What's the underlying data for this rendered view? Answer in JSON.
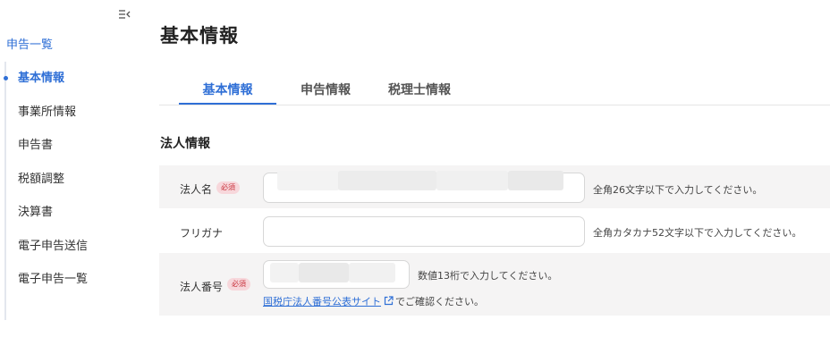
{
  "sidebar": {
    "top_link": "申告一覧",
    "items": [
      {
        "label": "基本情報",
        "active": true
      },
      {
        "label": "事業所情報",
        "active": false
      },
      {
        "label": "申告書",
        "active": false
      },
      {
        "label": "税額調整",
        "active": false
      },
      {
        "label": "決算書",
        "active": false
      },
      {
        "label": "電子申告送信",
        "active": false
      },
      {
        "label": "電子申告一覧",
        "active": false
      }
    ]
  },
  "page": {
    "title": "基本情報"
  },
  "tabs": [
    {
      "label": "基本情報",
      "active": true
    },
    {
      "label": "申告情報",
      "active": false
    },
    {
      "label": "税理士情報",
      "active": false
    }
  ],
  "section": {
    "title": "法人情報"
  },
  "form": {
    "required_badge": "必須",
    "corporate_name": {
      "label": "法人名",
      "value": "",
      "hint": "全角26文字以下で入力してください。"
    },
    "furigana": {
      "label": "フリガナ",
      "value": "",
      "hint": "全角カタカナ52文字以下で入力してください。"
    },
    "corporate_number": {
      "label": "法人番号",
      "value": "",
      "hint": "数値13桁で入力してください。",
      "link_text": "国税庁法人番号公表サイト",
      "link_suffix": "でご確認ください。"
    }
  },
  "colors": {
    "accent": "#2f6fd6",
    "row_bg": "#f5f4f4",
    "required_bg": "#f7d7db",
    "required_text": "#c8323c"
  },
  "icons": {
    "collapse": "sidebar-collapse-icon",
    "external": "external-link-icon"
  }
}
